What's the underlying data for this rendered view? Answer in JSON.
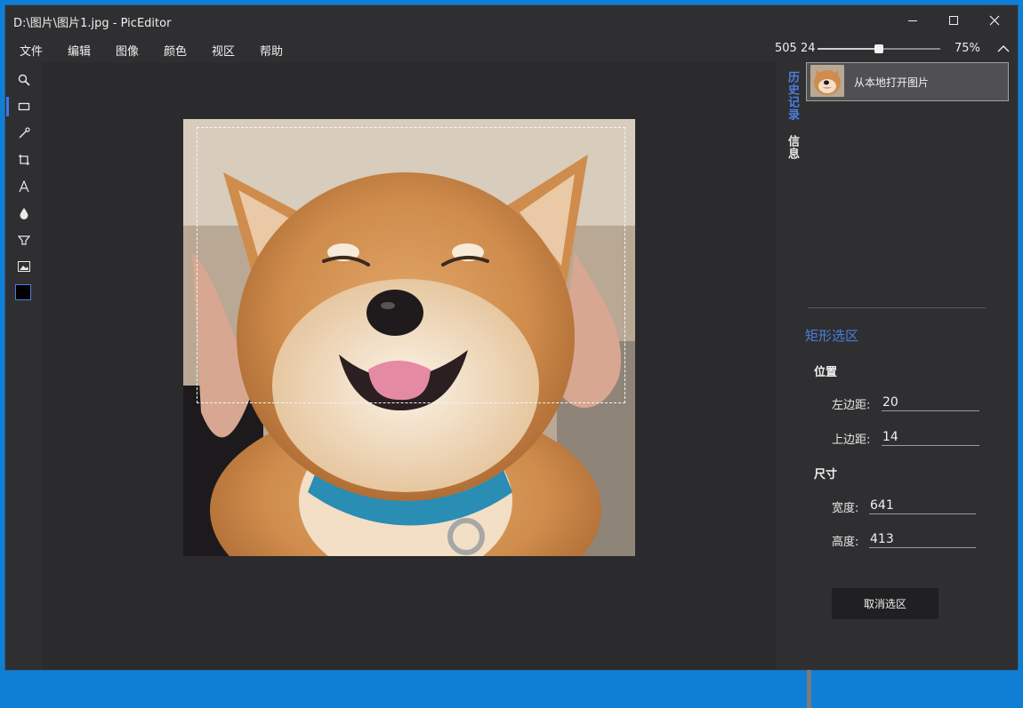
{
  "window": {
    "title": "D:\\图片\\图片1.jpg - PicEditor"
  },
  "menu": [
    "文件",
    "编辑",
    "图像",
    "颜色",
    "视区",
    "帮助"
  ],
  "status": {
    "coords": "505 24",
    "zoom_label": "75%",
    "zoom_fraction": 0.5
  },
  "toolbar": {
    "tools": [
      "magnifier-icon",
      "rectangle-select-icon",
      "eyedropper-icon",
      "crop-icon",
      "text-icon",
      "droplet-icon",
      "bucket-icon",
      "image-icon"
    ],
    "active_tool": "rectangle-select-icon",
    "current_color": "#000000"
  },
  "panel": {
    "tabs": [
      "历史记录",
      "信息"
    ],
    "active_tab": "历史记录",
    "history": [
      {
        "label": "从本地打开图片"
      }
    ]
  },
  "selection": {
    "title": "矩形选区",
    "position_label": "位置",
    "left_label": "左边距:",
    "left_value": "20",
    "top_label": "上边距:",
    "top_value": "14",
    "size_label": "尺寸",
    "width_label": "宽度:",
    "width_value": "641",
    "height_label": "高度:",
    "height_value": "413",
    "cancel_label": "取消选区"
  },
  "colors": {
    "accent": "#4a7ee0",
    "window_border": "#0f7fd6"
  }
}
